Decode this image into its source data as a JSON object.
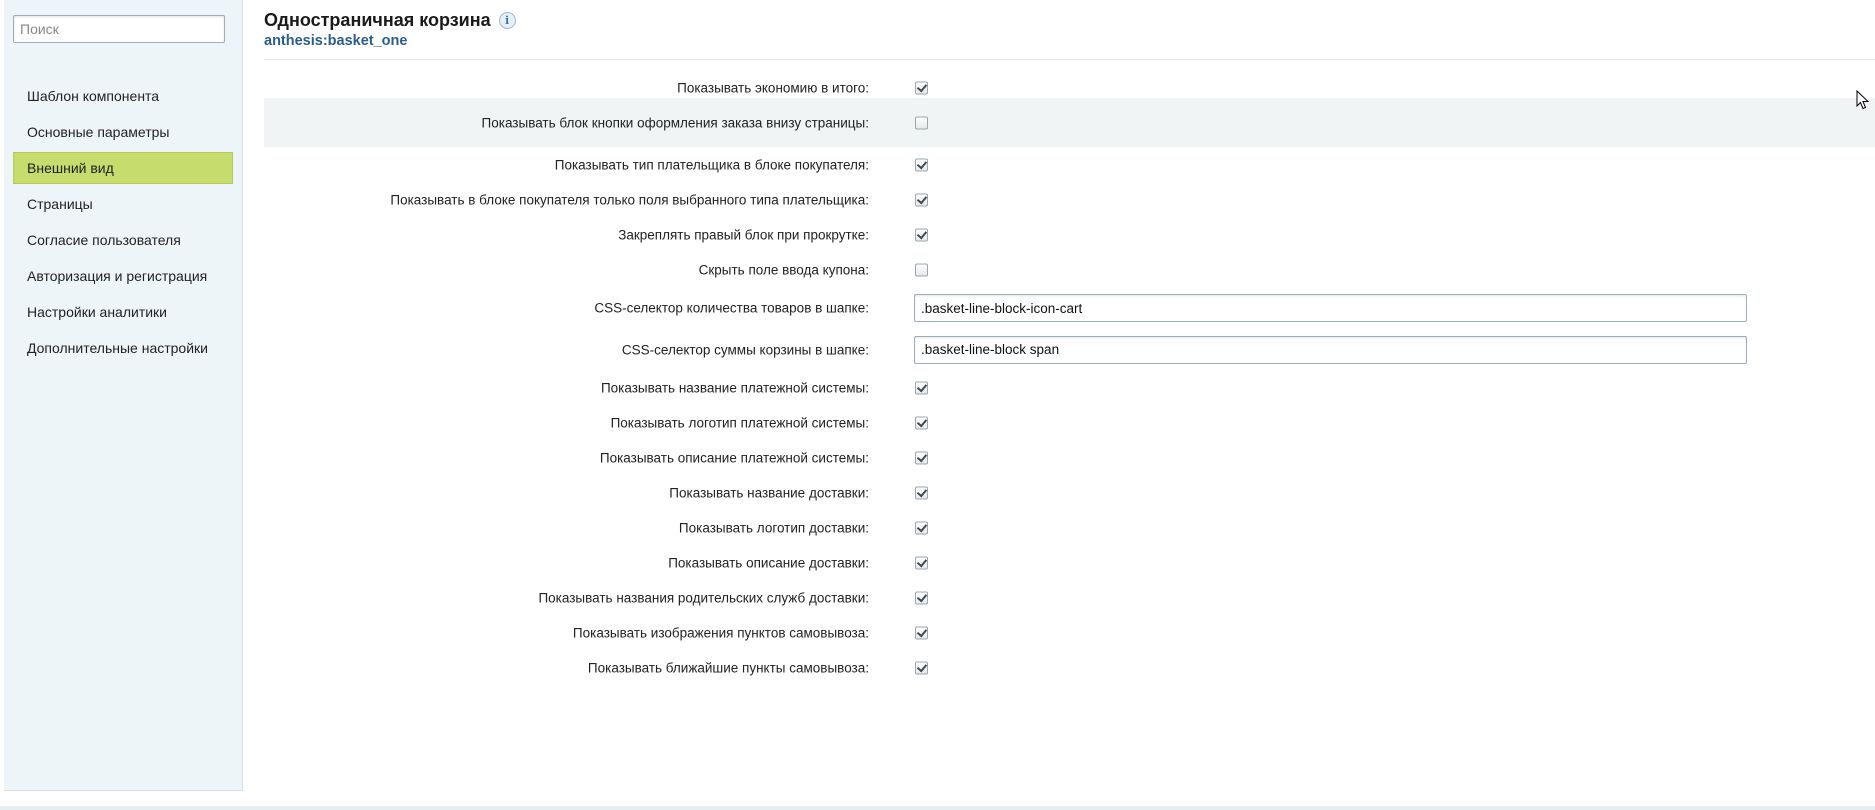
{
  "sidebar": {
    "search_placeholder": "Поиск",
    "items": [
      {
        "label": "Шаблон компонента",
        "active": false
      },
      {
        "label": "Основные параметры",
        "active": false
      },
      {
        "label": "Внешний вид",
        "active": true
      },
      {
        "label": "Страницы",
        "active": false
      },
      {
        "label": "Согласие пользователя",
        "active": false
      },
      {
        "label": "Авторизация и регистрация",
        "active": false
      },
      {
        "label": "Настройки аналитики",
        "active": false
      },
      {
        "label": "Дополнительные настройки",
        "active": false
      }
    ]
  },
  "header": {
    "title": "Одностраничная корзина",
    "info_icon": "info-icon",
    "component_code": "anthesis:basket_one"
  },
  "settings": [
    {
      "label": "Показывать экономию в итого:",
      "type": "checkbox",
      "checked": true
    },
    {
      "label": "Показывать блок кнопки оформления заказа внизу страницы:",
      "type": "checkbox",
      "checked": false,
      "highlighted": true
    },
    {
      "label": "Показывать тип плательщика в блоке покупателя:",
      "type": "checkbox",
      "checked": true
    },
    {
      "label": "Показывать в блоке покупателя только поля выбранного типа плательщика:",
      "type": "checkbox",
      "checked": true
    },
    {
      "label": "Закреплять правый блок при прокрутке:",
      "type": "checkbox",
      "checked": true
    },
    {
      "label": "Скрыть поле ввода купона:",
      "type": "checkbox",
      "checked": false
    },
    {
      "label": "CSS-селектор количества товаров в шапке:",
      "type": "text",
      "value": ".basket-line-block-icon-cart"
    },
    {
      "label": "CSS-селектор суммы корзины в шапке:",
      "type": "text",
      "value": ".basket-line-block span"
    },
    {
      "label": "Показывать название платежной системы:",
      "type": "checkbox",
      "checked": true
    },
    {
      "label": "Показывать логотип платежной системы:",
      "type": "checkbox",
      "checked": true
    },
    {
      "label": "Показывать описание платежной системы:",
      "type": "checkbox",
      "checked": true
    },
    {
      "label": "Показывать название доставки:",
      "type": "checkbox",
      "checked": true
    },
    {
      "label": "Показывать логотип доставки:",
      "type": "checkbox",
      "checked": true
    },
    {
      "label": "Показывать описание доставки:",
      "type": "checkbox",
      "checked": true
    },
    {
      "label": "Показывать названия родительских служб доставки:",
      "type": "checkbox",
      "checked": true
    },
    {
      "label": "Показывать изображения пунктов самовывоза:",
      "type": "checkbox",
      "checked": true
    },
    {
      "label": "Показывать ближайшие пункты самовывоза:",
      "type": "checkbox",
      "checked": true
    }
  ],
  "colors": {
    "sidebar_bg": "#eef5f8",
    "active_item_bg": "#c6dc6d",
    "subtitle_color": "#2b5d8c",
    "highlight_row_bg": "#f0f4f4"
  }
}
